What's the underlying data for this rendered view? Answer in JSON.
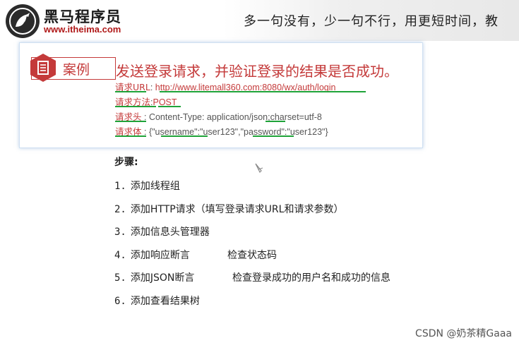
{
  "header": {
    "brand_cn": "黑马程序员",
    "brand_url": "www.itheima.com",
    "slogan": "多一句没有，少一句不行，用更短时间，教",
    "accent_color": "#b01919"
  },
  "case": {
    "badge_label": "案例",
    "title": "发送登录请求，并验证登录的结果是否成功。",
    "request_url_label": "请求URL",
    "request_url_value": "http://www.litemall360.com:8080/wx/auth/login",
    "request_method_label": "请求方法",
    "request_method_value": "POST",
    "request_header_label": "请求头",
    "request_header_value": "Content-Type: application/json;charset=utf-8",
    "request_body_label": "请求体",
    "request_body_value": "{\"username\":\"user123\",\"password\":\"user123\"}"
  },
  "steps": {
    "title": "步骤:",
    "items": [
      {
        "num": "1.",
        "text": "添加线程组",
        "note": ""
      },
      {
        "num": "2.",
        "text": "添加HTTP请求（填写登录请求URL和请求参数）",
        "note": ""
      },
      {
        "num": "3.",
        "text": "添加信息头管理器",
        "note": ""
      },
      {
        "num": "4.",
        "text": "添加响应断言",
        "note": "检查状态码"
      },
      {
        "num": "5.",
        "text": "添加JSON断言",
        "note": "检查登录成功的用户名和成功的信息"
      },
      {
        "num": "6.",
        "text": "添加查看结果树",
        "note": ""
      }
    ]
  },
  "watermark": "CSDN @奶茶精Gaaa"
}
